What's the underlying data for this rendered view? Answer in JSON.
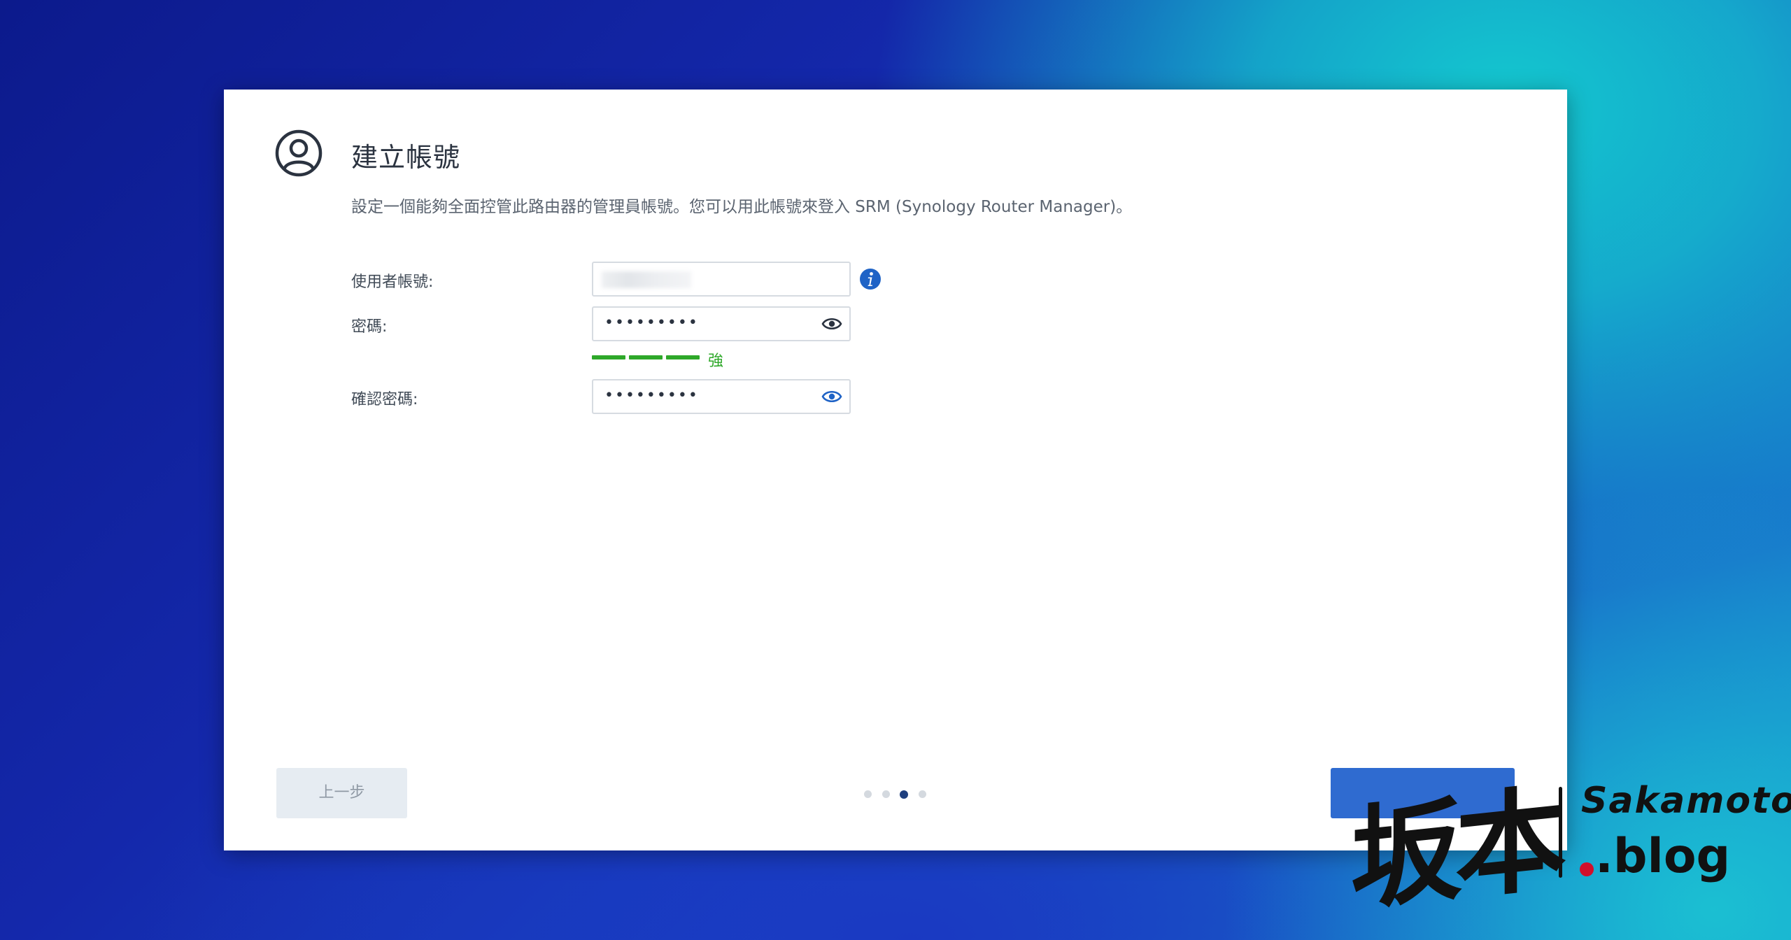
{
  "dialog": {
    "title": "建立帳號",
    "description": "設定一個能夠全面控管此路由器的管理員帳號。您可以用此帳號來登入 SRM (Synology Router Manager)。",
    "title_icon": "user-circle-icon"
  },
  "form": {
    "username": {
      "label": "使用者帳號:",
      "value": "",
      "info_icon": "info-icon"
    },
    "password": {
      "label": "密碼:",
      "value": "•••••••••",
      "eye_icon": "eye-icon",
      "strength_label": "強",
      "strength_segments_filled": 3,
      "strength_color": "#2ea829"
    },
    "confirm_password": {
      "label": "確認密碼:",
      "value": "•••••••••",
      "eye_icon": "eye-icon",
      "eye_color": "#1f63c6"
    }
  },
  "footer": {
    "prev_label": "上一步",
    "steps_total": 4,
    "steps_current": 3,
    "next_color": "#2f6bd0"
  },
  "watermark": {
    "kanji": "坂本",
    "name": "Sakamoto",
    "domain": ".blog"
  }
}
